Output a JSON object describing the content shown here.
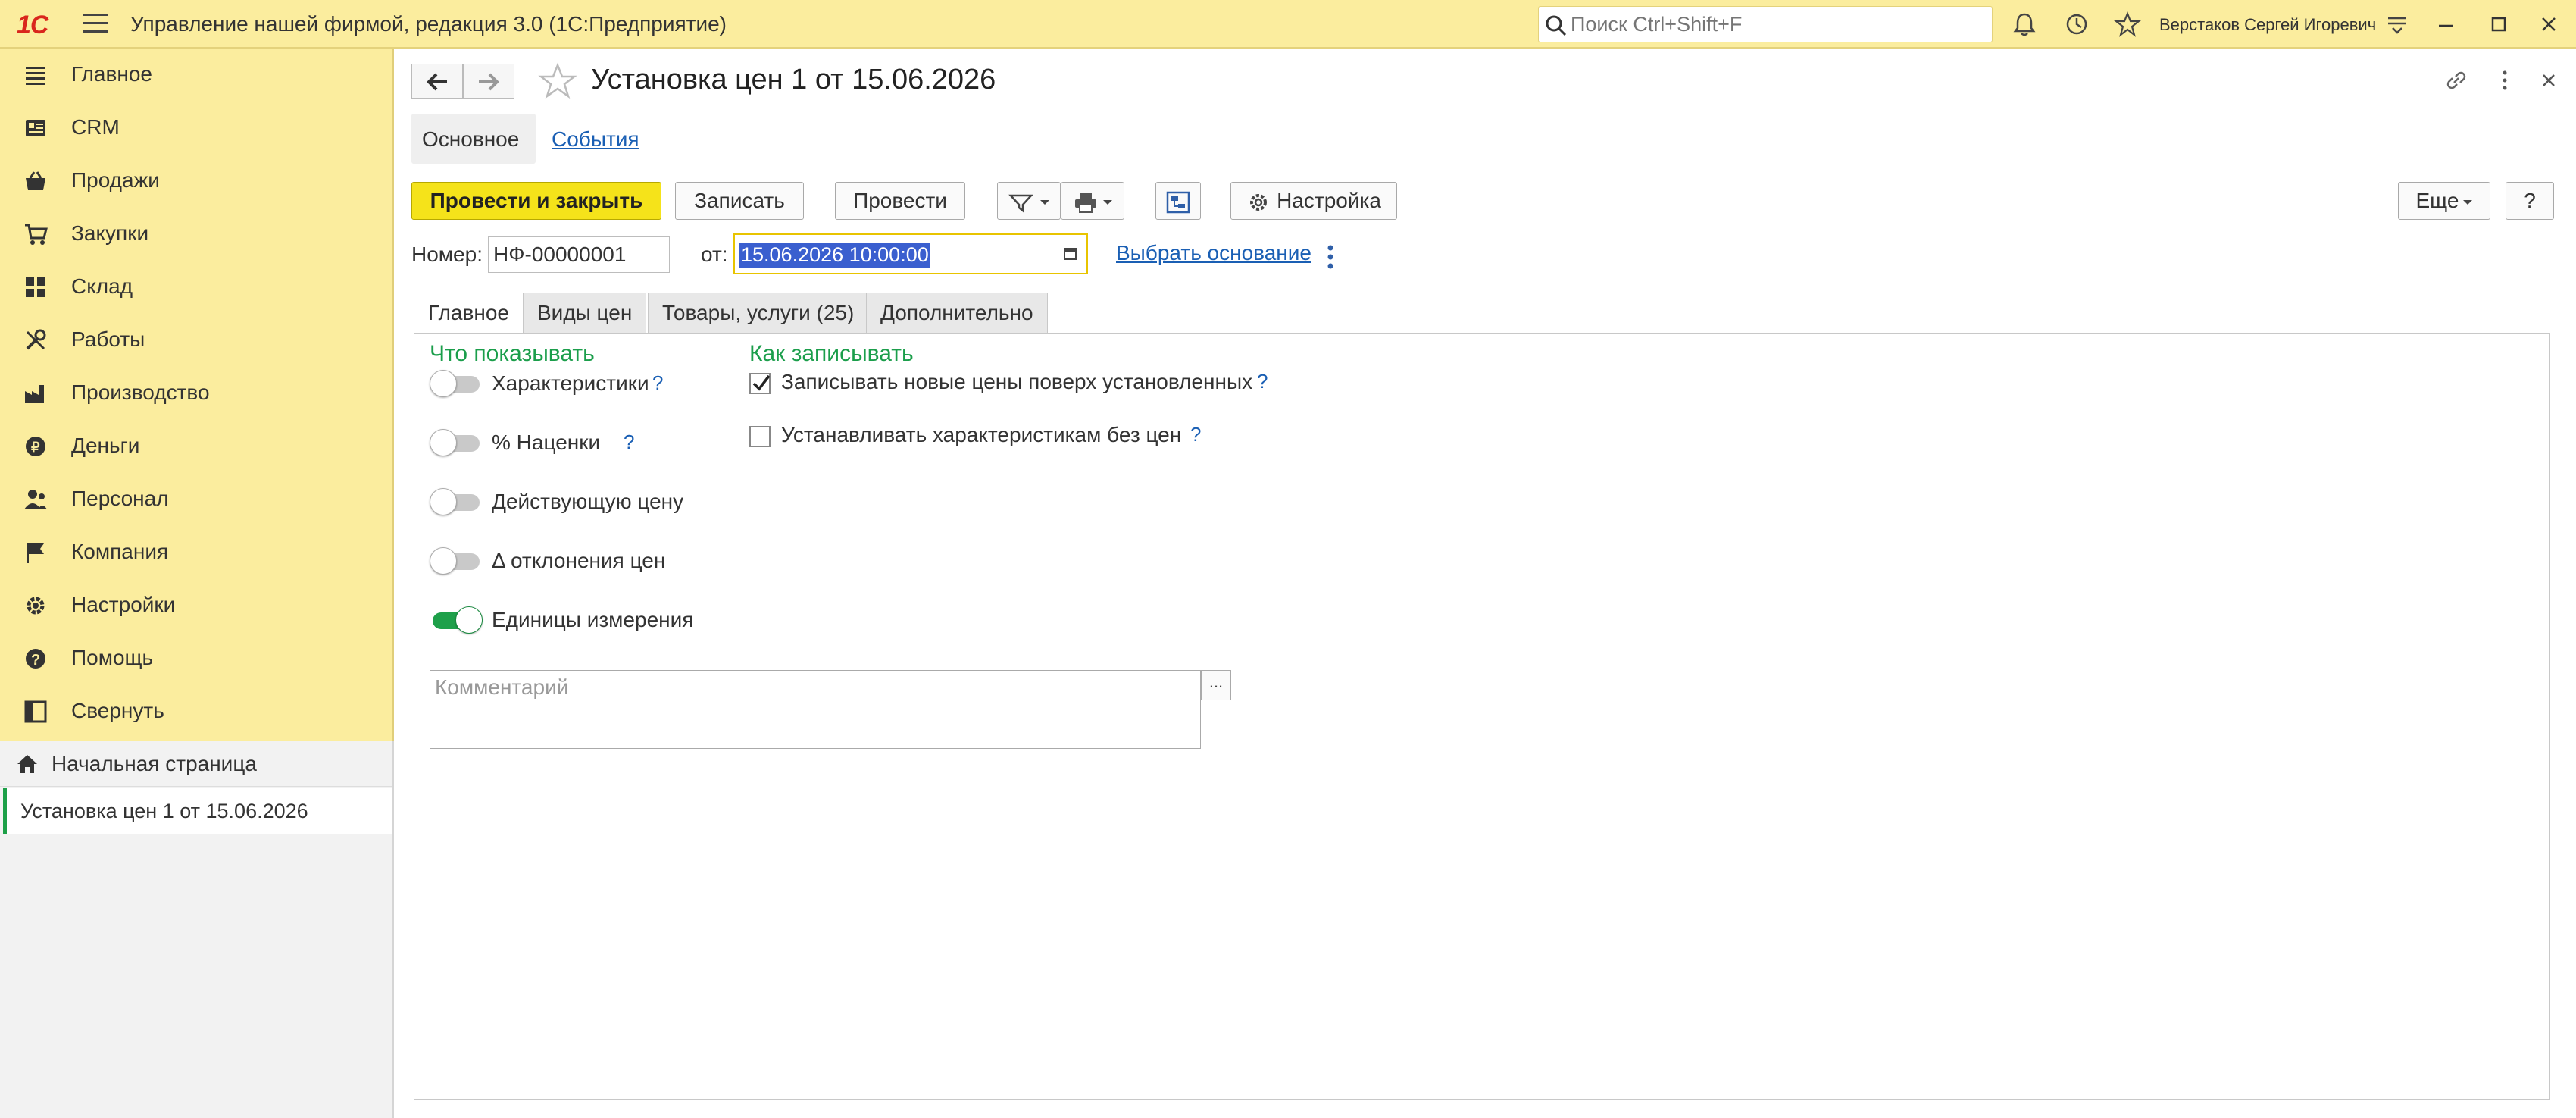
{
  "titlebar": {
    "logo": "1С",
    "app_title": "Управление нашей фирмой, редакция 3.0  (1С:Предприятие)",
    "search_placeholder": "Поиск Ctrl+Shift+F",
    "user_name": "Верстаков Сергей Игоревич"
  },
  "sidebar": {
    "items": [
      {
        "label": "Главное",
        "icon": "list-icon"
      },
      {
        "label": "CRM",
        "icon": "crm-icon"
      },
      {
        "label": "Продажи",
        "icon": "basket-icon"
      },
      {
        "label": "Закупки",
        "icon": "purchase-icon"
      },
      {
        "label": "Склад",
        "icon": "warehouse-icon"
      },
      {
        "label": "Работы",
        "icon": "tools-icon"
      },
      {
        "label": "Производство",
        "icon": "factory-icon"
      },
      {
        "label": "Деньги",
        "icon": "money-icon"
      },
      {
        "label": "Персонал",
        "icon": "staff-icon"
      },
      {
        "label": "Компания",
        "icon": "flag-icon"
      },
      {
        "label": "Настройки",
        "icon": "gear-icon"
      },
      {
        "label": "Помощь",
        "icon": "help-icon"
      },
      {
        "label": "Свернуть",
        "icon": "collapse-icon"
      }
    ],
    "home_label": "Начальная страница",
    "open_window_label": "Установка цен 1 от 15.06.2026"
  },
  "form": {
    "title": "Установка цен 1 от 15.06.2026",
    "tab_main": "Основное",
    "tab_events": "События",
    "btn_post_close": "Провести и закрыть",
    "btn_save": "Записать",
    "btn_post": "Провести",
    "btn_settings": "Настройка",
    "btn_more": "Еще",
    "btn_help": "?",
    "number_label": "Номер:",
    "number_value": "НФ-00000001",
    "date_label": "от:",
    "date_value": "15.06.2026 10:00:00",
    "base_link": "Выбрать основание",
    "tabs": [
      "Главное",
      "Виды цен",
      "Товары, услуги (25)",
      "Дополнительно"
    ],
    "show_group_title": "Что показывать",
    "toggles": [
      {
        "label": "Характеристики",
        "on": false,
        "help": "?"
      },
      {
        "label": "% Наценки",
        "on": false,
        "help": "?"
      },
      {
        "label": "Действующую цену",
        "on": false,
        "help": ""
      },
      {
        "label": "Δ отклонения цен",
        "on": false,
        "help": ""
      },
      {
        "label": "Единицы измерения",
        "on": true,
        "help": ""
      }
    ],
    "write_group_title": "Как записывать",
    "checkboxes": [
      {
        "label": "Записывать новые цены поверх установленных",
        "checked": true,
        "help": "?"
      },
      {
        "label": "Устанавливать характеристикам без цен",
        "checked": false,
        "help": "?"
      }
    ],
    "comment_placeholder": "Комментарий",
    "comment_button": "..."
  },
  "colors": {
    "accent_yellow": "#fbed9e",
    "primary_button": "#f5e31a",
    "group_green": "#1b9e4b",
    "link_blue": "#1a5fb4",
    "toggle_on": "#1ea04a"
  }
}
